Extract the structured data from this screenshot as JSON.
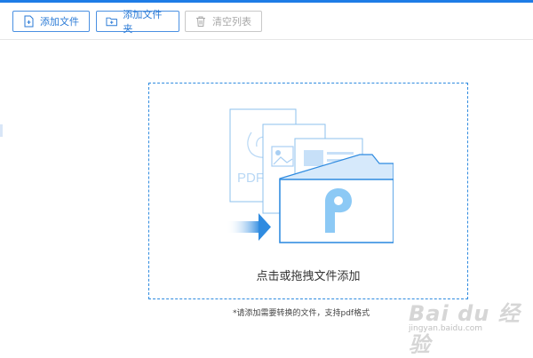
{
  "toolbar": {
    "add_file_label": "添加文件",
    "add_folder_label": "添加文件夹",
    "clear_list_label": "清空列表"
  },
  "dropzone": {
    "text": "点击或拖拽文件添加",
    "pdf_label": "PDF"
  },
  "hint": {
    "text": "*请添加需要转换的文件，支持pdf格式"
  },
  "watermark": {
    "brand": "Bai du 经验",
    "url": "jingyan.baidu.com"
  },
  "colors": {
    "accent": "#1e7ce6",
    "border": "#4a90e2",
    "disabled": "#a8a8a8",
    "dropzone_border": "#2f8be0"
  },
  "icons": [
    "add-file-icon",
    "add-folder-icon",
    "trash-icon",
    "pdf-document-icon",
    "image-document-icon",
    "text-document-icon",
    "folder-icon",
    "p-logo-icon",
    "arrow-right-icon"
  ]
}
